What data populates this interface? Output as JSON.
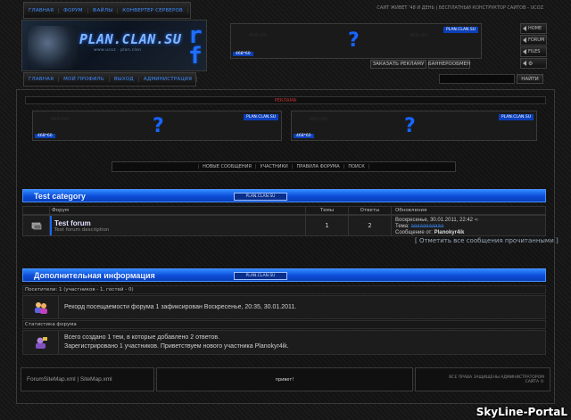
{
  "topnav": [
    "главная",
    "форум",
    "файлы",
    "конвертер серверов"
  ],
  "top_right": "сайт живет '48 й день | бесплатный конструктор сайтов - ucoz",
  "logo": {
    "title": "PLAN.CLAN.SU",
    "subtitle": "www.ucoz · plan.clan"
  },
  "banner_tag": "PLAN.CLAN.SU",
  "banner_kb": "468*60",
  "banner_buttons": [
    "Заказать рекламу",
    "Баннерообмен"
  ],
  "side": [
    "home",
    "forum",
    "files",
    ""
  ],
  "nav2": [
    "главная",
    "мой профиль",
    "выход",
    "администрация"
  ],
  "search_btn": "найти",
  "ad_label": "реклама",
  "forum_menu": [
    "новые сообщения",
    "участники",
    "правила форума",
    "поиск"
  ],
  "category": {
    "title": "Test category",
    "badge": "PLAN.CLAN.SU"
  },
  "table": {
    "headers": [
      "Форум",
      "Темы",
      "Ответы",
      "Обновления"
    ],
    "row": {
      "title": "Test forum",
      "desc": "Test forum description",
      "topics": "1",
      "replies": "2",
      "upd_date": "Воскресенье, 30.01.2011, 22:42",
      "upd_topic_label": "Тема:",
      "upd_topic": "ааааааааааа",
      "upd_msg_label": "Сообщение от:",
      "upd_user": "Planokyr4ik"
    }
  },
  "mark_read": "[ Отметить все сообщения прочитанными ]",
  "info": {
    "title": "Дополнительная информация",
    "badge": "PLAN.CLAN.SU",
    "visitors_label": "Посетители: 1 (участников - 1, гостей - 0)",
    "record": "Рекорд посещаемости форума 1 зафиксирован Воскресенье, 20:35, 30.01.2011.",
    "stats_label": "Статистика форума",
    "stats1": "Всего создано 1 тем, в которые добавлено 2 ответов.",
    "stats2": "Зарегистрировано 1 участников. Приветствуем нового участника Planokyr4ik."
  },
  "footer": {
    "links": "ForumSiteMap.xml | SiteMap.xml",
    "center": "привет!",
    "right1": "все права защищены администратором",
    "right2": "сайта ©"
  },
  "watermark": "SkyLine-PortaL",
  "colors": {
    "accent": "#1565ff",
    "bg": "#151515"
  }
}
